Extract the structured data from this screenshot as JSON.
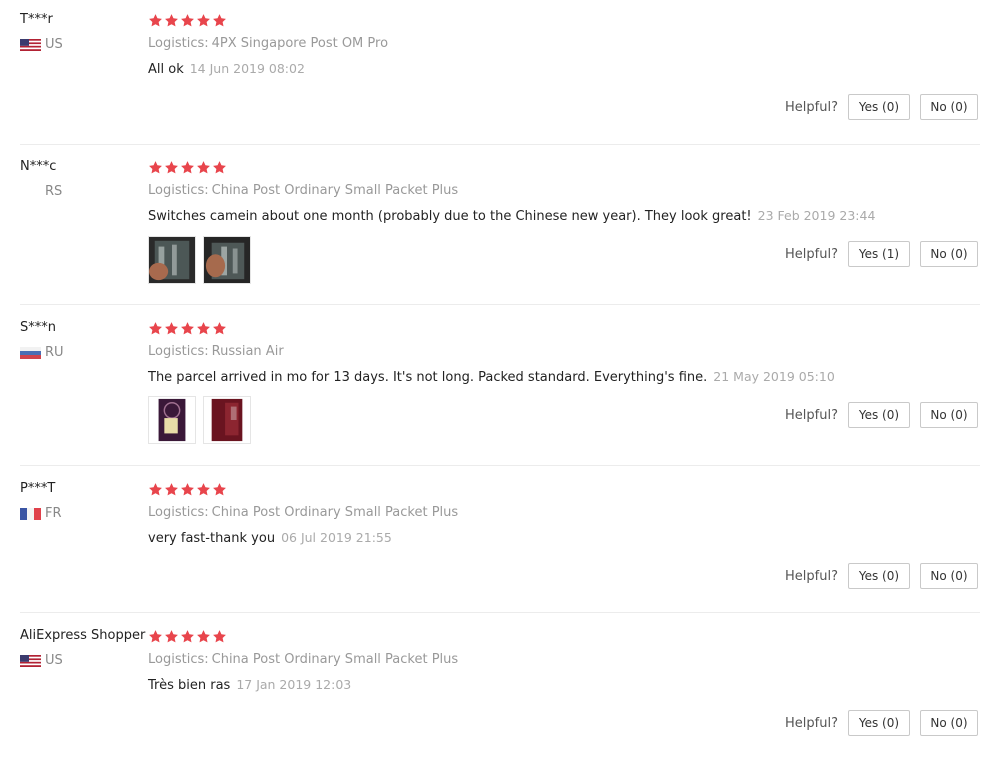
{
  "colors": {
    "star": "#e8454c",
    "divider": "#ececec"
  },
  "labels": {
    "logistics": "Logistics:",
    "helpful": "Helpful?"
  },
  "reviews": [
    {
      "user": "T***r",
      "country_code": "US",
      "flag_icon": "us-flag-icon",
      "rating": 5,
      "logistics": "4PX Singapore Post OM Pro",
      "feedback": "All ok",
      "date": "14 Jun 2019 08:02",
      "photos": [],
      "yes_label": "Yes (0)",
      "no_label": "No (0)"
    },
    {
      "user": "N***c",
      "country_code": "RS",
      "flag_icon": "",
      "rating": 5,
      "logistics": "China Post Ordinary Small Packet Plus",
      "feedback": "Switches camein about one month (probably due to the Chinese new year). They look great!",
      "date": "23 Feb 2019 23:44",
      "photos": [
        "switches-photo-1",
        "switches-photo-2"
      ],
      "yes_label": "Yes (1)",
      "no_label": "No (0)"
    },
    {
      "user": "S***n",
      "country_code": "RU",
      "flag_icon": "ru-flag-icon",
      "rating": 5,
      "logistics": "Russian Air",
      "feedback": "The parcel arrived in mo for 13 days. It's not long. Packed standard. Everything's fine.",
      "date": "21 May 2019 05:10",
      "photos": [
        "parcel-photo-1",
        "parcel-photo-2"
      ],
      "yes_label": "Yes (0)",
      "no_label": "No (0)"
    },
    {
      "user": "P***T",
      "country_code": "FR",
      "flag_icon": "fr-flag-icon",
      "rating": 5,
      "logistics": "China Post Ordinary Small Packet Plus",
      "feedback": "very fast-thank you",
      "date": "06 Jul 2019 21:55",
      "photos": [],
      "yes_label": "Yes (0)",
      "no_label": "No (0)"
    },
    {
      "user": "AliExpress Shopper",
      "country_code": "US",
      "flag_icon": "us-flag-icon",
      "rating": 5,
      "logistics": "China Post Ordinary Small Packet Plus",
      "feedback": "Très bien ras",
      "date": "17 Jan 2019 12:03",
      "photos": [],
      "yes_label": "Yes (0)",
      "no_label": "No (0)"
    }
  ]
}
